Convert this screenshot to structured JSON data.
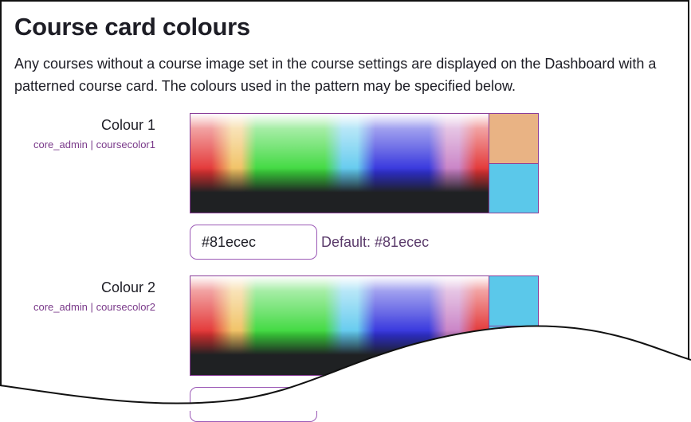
{
  "page": {
    "title": "Course card colours",
    "description": "Any courses without a course image set in the course settings are displayed on the Dashboard with a patterned course card. The colours used in the pattern may be specified below."
  },
  "settings": [
    {
      "label": "Colour 1",
      "component": "core_admin",
      "separator": "|",
      "name": "coursecolor1",
      "value": "#81ecec",
      "default_label": "Default: #81ecec",
      "swatch_previous": "#e9b384",
      "swatch_current": "#5bc8ea"
    },
    {
      "label": "Colour 2",
      "component": "core_admin",
      "separator": "|",
      "name": "coursecolor2",
      "value": "",
      "swatch_previous": "#5bc8ea",
      "swatch_current": "#5bc8ea"
    }
  ],
  "colors": {
    "heading": "#1d1d25",
    "accent": "#9b59b6"
  }
}
